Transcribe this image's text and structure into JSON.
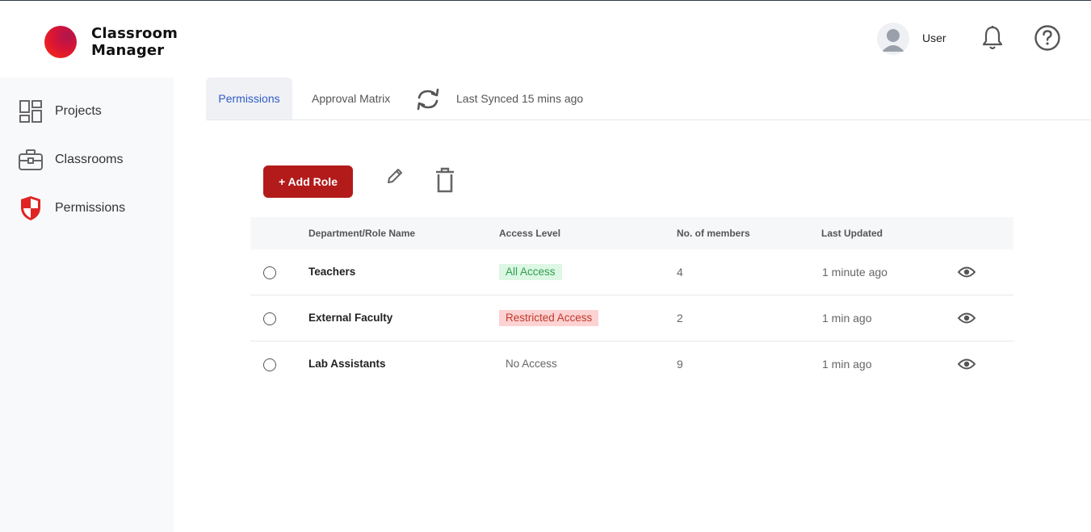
{
  "brand": {
    "line1": "Classroom",
    "line2": "Manager"
  },
  "header": {
    "user_name": "User",
    "icons": [
      "avatar",
      "bell-icon",
      "help-icon"
    ]
  },
  "sidebar": {
    "items": [
      {
        "label": "Projects",
        "icon": "dashboard-grid-icon"
      },
      {
        "label": "Classrooms",
        "icon": "briefcase-icon"
      },
      {
        "label": "Permissions",
        "icon": "shield-icon"
      }
    ]
  },
  "tabs": {
    "items": [
      {
        "label": "Permissions",
        "active": true
      },
      {
        "label": "Approval Matrix",
        "active": false
      }
    ],
    "sync_text": "Last Synced 15 mins ago"
  },
  "toolbar": {
    "add_label": "+ Add Role",
    "icons": [
      "pencil-icon",
      "trash-icon"
    ]
  },
  "table": {
    "headers": [
      "Department/Role Name",
      "Access Level",
      "No. of members",
      "Last Updated"
    ],
    "rows": [
      {
        "name": "Teachers",
        "access": "All Access",
        "access_type": "all",
        "members": "4",
        "updated": "1 minute ago"
      },
      {
        "name": "External Faculty",
        "access": "Restricted Access",
        "access_type": "restricted",
        "members": "2",
        "updated": "1 min ago"
      },
      {
        "name": "Lab Assistants",
        "access": "No Access",
        "access_type": "none",
        "members": "9",
        "updated": "1 min ago"
      }
    ]
  },
  "colors": {
    "accent_red": "#b31b1b",
    "active_tab_text": "#2f5cc5",
    "all_access_bg": "#dcf7e3",
    "all_access_text": "#2f9e4f",
    "restricted_bg": "#fcd2d2",
    "restricted_text": "#c0392b",
    "shield_red": "#e02424"
  }
}
